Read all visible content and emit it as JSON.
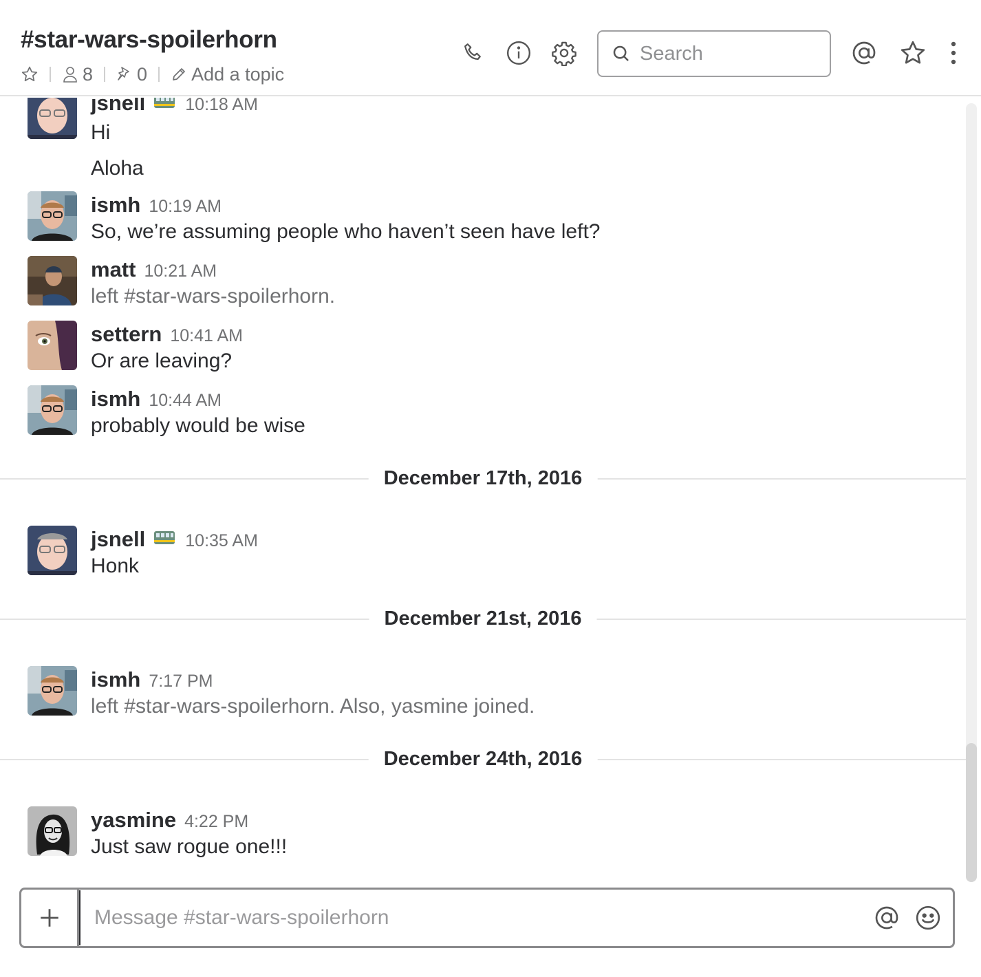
{
  "channel": {
    "title": "#star-wars-spoilerhorn",
    "members_count": "8",
    "pins_count": "0",
    "add_topic": "Add a topic"
  },
  "header_icons": [
    "phone-icon",
    "info-icon",
    "gear-icon",
    "at-icon",
    "star-icon",
    "more-icon"
  ],
  "search": {
    "placeholder": "Search"
  },
  "messages": [
    {
      "author": "jsnell",
      "status_emoji": "train",
      "time": "10:18 AM",
      "lines": [
        "Hi",
        "Aloha"
      ]
    },
    {
      "author": "ismh",
      "time": "10:19 AM",
      "text": "So, we’re assuming people who haven’t seen have left?"
    },
    {
      "author": "matt",
      "time": "10:21 AM",
      "text": "left #star-wars-spoilerhorn.",
      "muted": true
    },
    {
      "author": "settern",
      "time": "10:41 AM",
      "text": "Or are leaving?"
    },
    {
      "author": "ismh",
      "time": "10:44 AM",
      "text": "probably would be wise"
    },
    {
      "divider": "December 17th, 2016"
    },
    {
      "author": "jsnell",
      "status_emoji": "train",
      "time": "10:35 AM",
      "text": "Honk"
    },
    {
      "divider": "December 21st, 2016"
    },
    {
      "author": "ismh",
      "time": "7:17 PM",
      "text": "left #star-wars-spoilerhorn. Also, yasmine joined.",
      "muted": true
    },
    {
      "divider": "December 24th, 2016"
    },
    {
      "author": "yasmine",
      "time": "4:22 PM",
      "text": "Just saw rogue one!!!"
    }
  ],
  "composer": {
    "placeholder": "Message #star-wars-spoilerhorn"
  },
  "colors": {
    "text": "#2c2d30",
    "muted": "#717274",
    "border": "#e3e3e3"
  }
}
